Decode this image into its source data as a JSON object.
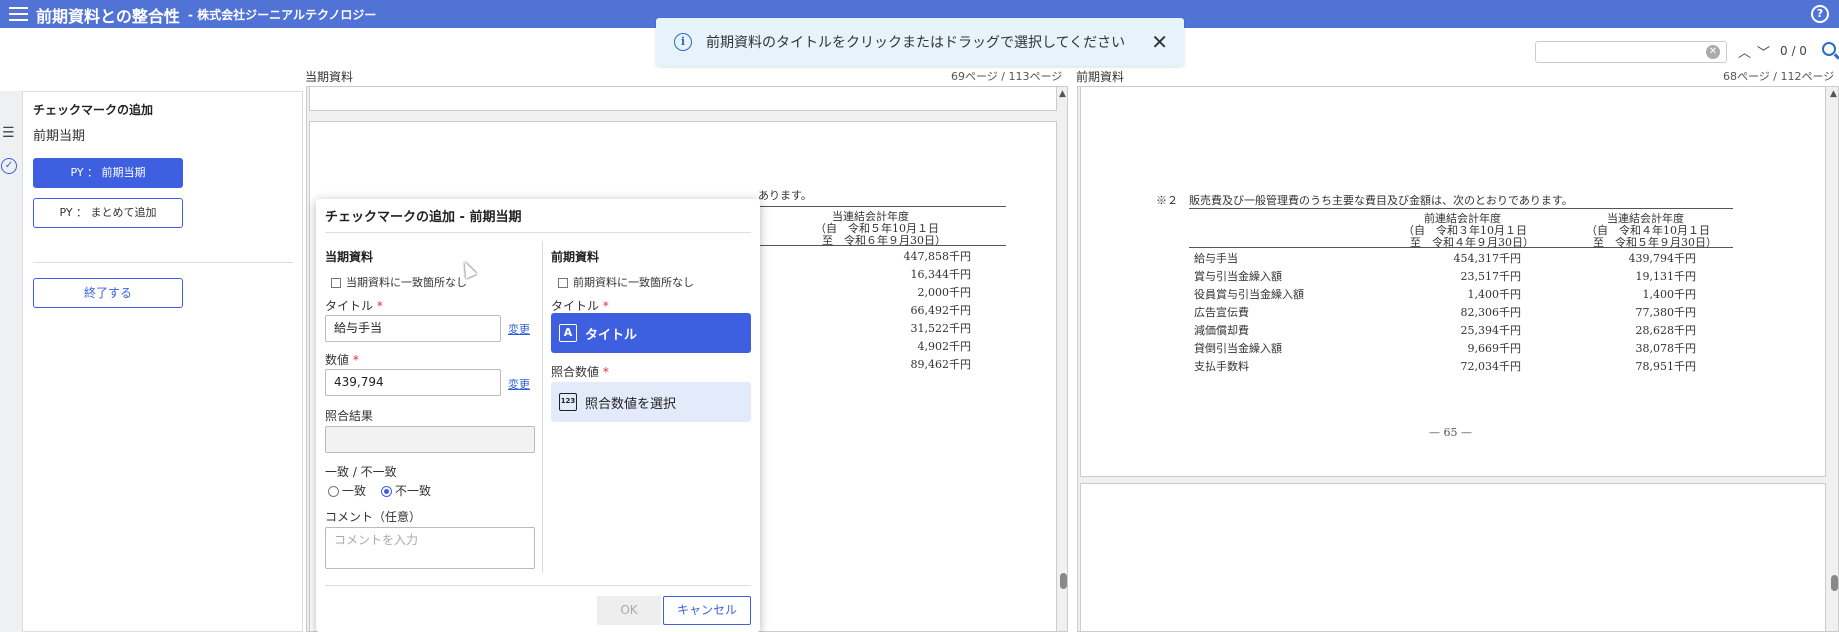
{
  "header": {
    "title": "前期資料との整合性",
    "subtitle": "- 株式会社ジーニアルテクノロジー",
    "help_glyph": "?"
  },
  "toast": {
    "info_glyph": "i",
    "message": "前期資料のタイトルをクリックまたはドラッグで選択してください",
    "close_glyph": "✕"
  },
  "search": {
    "value": "",
    "count": "0 / 0"
  },
  "sidebar": {
    "title": "チェックマークの追加",
    "subtitle": "前期当期",
    "btn_py_current": "PY ： 前期当期",
    "btn_py_bulk": "PY ： まとめて追加",
    "btn_end": "終了する"
  },
  "current_doc": {
    "label": "当期資料",
    "pages": "69ページ / 113ページ",
    "heading_fragment": "あります。",
    "col_header_1": "当連結会計年度",
    "col_header_2": "（自　令和５年10月１日",
    "col_header_3": "至　令和６年９月30日）",
    "values": [
      "447,858千円",
      "16,344千円",
      "2,000千円",
      "66,492千円",
      "31,522千円",
      "4,902千円",
      "89,462千円"
    ]
  },
  "prior_doc": {
    "label": "前期資料",
    "pages": "68ページ / 112ページ",
    "note": "※２　販売費及び一般管理費のうち主要な費目及び金額は、次のとおりであります。",
    "prior_col_1": "前連結会計年度",
    "prior_col_2": "（自　令和３年10月１日",
    "prior_col_3": "至　令和４年９月30日）",
    "cur_col_1": "当連結会計年度",
    "cur_col_2": "（自　令和４年10月１日",
    "cur_col_3": "至　令和５年９月30日）",
    "rows": [
      {
        "item": "給与手当",
        "prior": "454,317千円",
        "current": "439,794千円"
      },
      {
        "item": "賞与引当金繰入額",
        "prior": "23,517千円",
        "current": "19,131千円"
      },
      {
        "item": "役員賞与引当金繰入額",
        "prior": "1,400千円",
        "current": "1,400千円"
      },
      {
        "item": "広告宣伝費",
        "prior": "82,306千円",
        "current": "77,380千円"
      },
      {
        "item": "減価償却費",
        "prior": "25,394千円",
        "current": "28,628千円"
      },
      {
        "item": "貸倒引当金繰入額",
        "prior": "9,669千円",
        "current": "38,078千円"
      },
      {
        "item": "支払手数料",
        "prior": "72,034千円",
        "current": "78,951千円"
      }
    ],
    "page_number": "— 65 —"
  },
  "dialog": {
    "title": "チェックマークの追加 - 前期当期",
    "current_section": "当期資料",
    "current_no_match": "当期資料に一致箇所なし",
    "title_label": "タイトル",
    "required": "*",
    "title_value": "給与手当",
    "change_link": "変更",
    "value_label": "数値",
    "value_value": "439,794",
    "result_label": "照合結果",
    "match_label": "一致 / 不一致",
    "match_option": "一致",
    "mismatch_option": "不一致",
    "comment_label": "コメント（任意）",
    "comment_placeholder": "コメントを入力",
    "prior_section": "前期資料",
    "prior_no_match": "前期資料に一致箇所なし",
    "prior_title_label": "タイトル",
    "prior_title_button": "タイトル",
    "prior_value_label": "照合数値",
    "prior_value_button": "照合数値を選択",
    "title_btn_icon": "A",
    "value_btn_icon": "123",
    "ok": "OK",
    "cancel": "キャンセル"
  }
}
